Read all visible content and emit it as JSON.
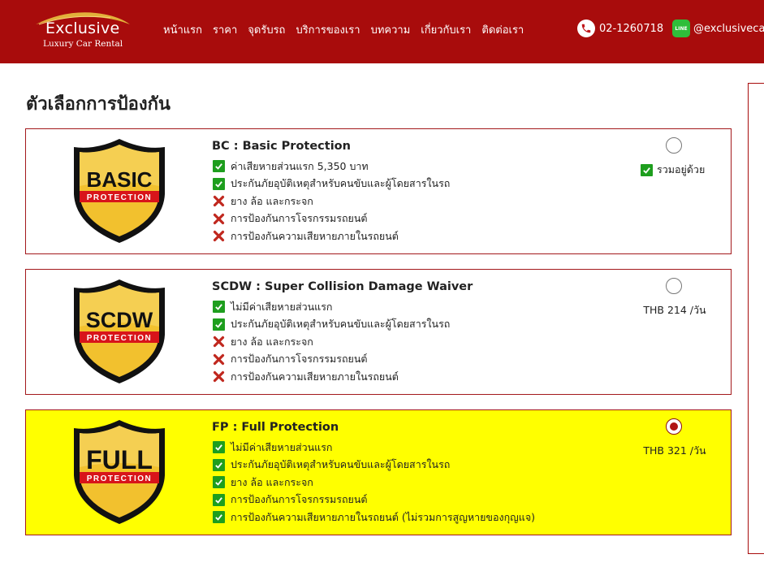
{
  "header": {
    "logo_main": "Exclusive",
    "logo_sub": "Luxury Car Rental",
    "nav": [
      "หน้าแรก",
      "ราคา",
      "จุดรับรถ",
      "บริการของเรา",
      "บทความ",
      "เกี่ยวกับเรา",
      "ติดต่อเรา"
    ],
    "phone": "02-1260718",
    "line_label": "LINE",
    "line_id": "@exclusivecar"
  },
  "page": {
    "title": "ตัวเลือกการป้องกัน"
  },
  "colors": {
    "brand_red": "#a80c0c",
    "selected_bg": "#ffff00",
    "check_green": "#1e9e1e",
    "cross_red": "#c0271e"
  },
  "options": [
    {
      "badge": "BASIC",
      "badge_sub": "PROTECTION",
      "title": "BC : Basic Protection",
      "features": [
        {
          "icon": "check-icon",
          "text": "ค่าเสียหายส่วนแรก 5,350 บาท"
        },
        {
          "icon": "check-icon",
          "text": "ประกันภัยอุบัติเหตุสำหรับคนขับและผู้โดยสารในรถ"
        },
        {
          "icon": "cross-icon",
          "text": "ยาง ล้อ และกระจก"
        },
        {
          "icon": "cross-icon",
          "text": "การป้องกันการโจรกรรมรถยนต์"
        },
        {
          "icon": "cross-icon",
          "text": "การป้องกันความเสียหายภายในรถยนต์"
        }
      ],
      "price": "",
      "included_label": "รวมอยู่ด้วย",
      "selected": false
    },
    {
      "badge": "SCDW",
      "badge_sub": "PROTECTION",
      "title": "SCDW : Super Collision Damage Waiver",
      "features": [
        {
          "icon": "check-icon",
          "text": "ไม่มีค่าเสียหายส่วนแรก"
        },
        {
          "icon": "check-icon",
          "text": "ประกันภัยอุบัติเหตุสำหรับคนขับและผู้โดยสารในรถ"
        },
        {
          "icon": "cross-icon",
          "text": "ยาง ล้อ และกระจก"
        },
        {
          "icon": "cross-icon",
          "text": "การป้องกันการโจรกรรมรถยนต์"
        },
        {
          "icon": "cross-icon",
          "text": "การป้องกันความเสียหายภายในรถยนต์"
        }
      ],
      "price": "THB 214 /วัน",
      "included_label": "",
      "selected": false
    },
    {
      "badge": "FULL",
      "badge_sub": "PROTECTION",
      "title": "FP : Full Protection",
      "features": [
        {
          "icon": "check-icon",
          "text": "ไม่มีค่าเสียหายส่วนแรก"
        },
        {
          "icon": "check-icon",
          "text": "ประกันภัยอุบัติเหตุสำหรับคนขับและผู้โดยสารในรถ"
        },
        {
          "icon": "check-icon",
          "text": "ยาง ล้อ และกระจก"
        },
        {
          "icon": "check-icon",
          "text": "การป้องกันการโจรกรรมรถยนต์"
        },
        {
          "icon": "check-icon",
          "text": "การป้องกันความเสียหายภายในรถยนต์ (ไม่รวมการสูญหายของกุญแจ)"
        }
      ],
      "price": "THB 321 /วัน",
      "included_label": "",
      "selected": true
    }
  ]
}
